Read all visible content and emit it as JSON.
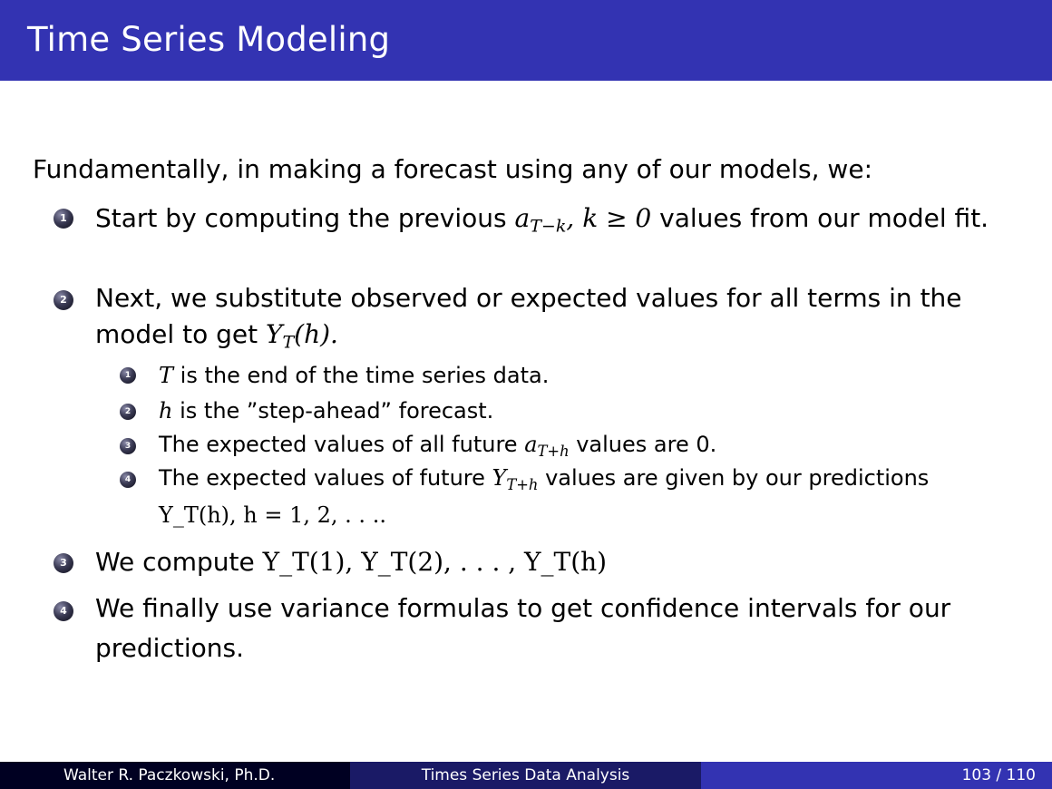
{
  "slide": {
    "title": "Time Series Modeling",
    "intro": "Fundamentally, in making a forecast using any of our models, we:",
    "items": [
      {
        "number": "1",
        "text_before": "Start by computing the previous",
        "math_var": "a",
        "math_sub": "T−k",
        "math_rest": ", k ≥ 0",
        "text_after": "values from our model fit."
      },
      {
        "number": "2",
        "text": "Next, we substitute observed or expected values for all terms in the model to get",
        "math_var": "Y",
        "math_sub": "T",
        "math_rest": "(h).",
        "subitems": [
          {
            "number": "1",
            "math": "T",
            "text": "is the end of the time series data."
          },
          {
            "number": "2",
            "math": "h",
            "text": "is the ”step-ahead” forecast."
          },
          {
            "number": "3",
            "text_before": "The expected values of all future",
            "math_var": "a",
            "math_sub": "T+h",
            "text_after": "values are 0."
          },
          {
            "number": "4",
            "text_before": "The expected values of future",
            "math_var": "Y",
            "math_sub": "T+h",
            "text_after": "values are given by our predictions",
            "math_line": "Y_T(h), h = 1, 2, . . .."
          }
        ]
      },
      {
        "number": "3",
        "text": "We compute",
        "math": "Y_T(1), Y_T(2), . . . , Y_T(h)"
      },
      {
        "number": "4",
        "text": "We finally use variance formulas to get confidence intervals for our predictions."
      }
    ]
  },
  "footer": {
    "author": "Walter R. Paczkowski, Ph.D.",
    "course": "Times Series Data Analysis",
    "page": "103 / 110"
  },
  "colors": {
    "titlebar": "#3333b2",
    "footer_left": "#000022",
    "footer_middle": "#1a1a66",
    "footer_right": "#3333b2"
  }
}
